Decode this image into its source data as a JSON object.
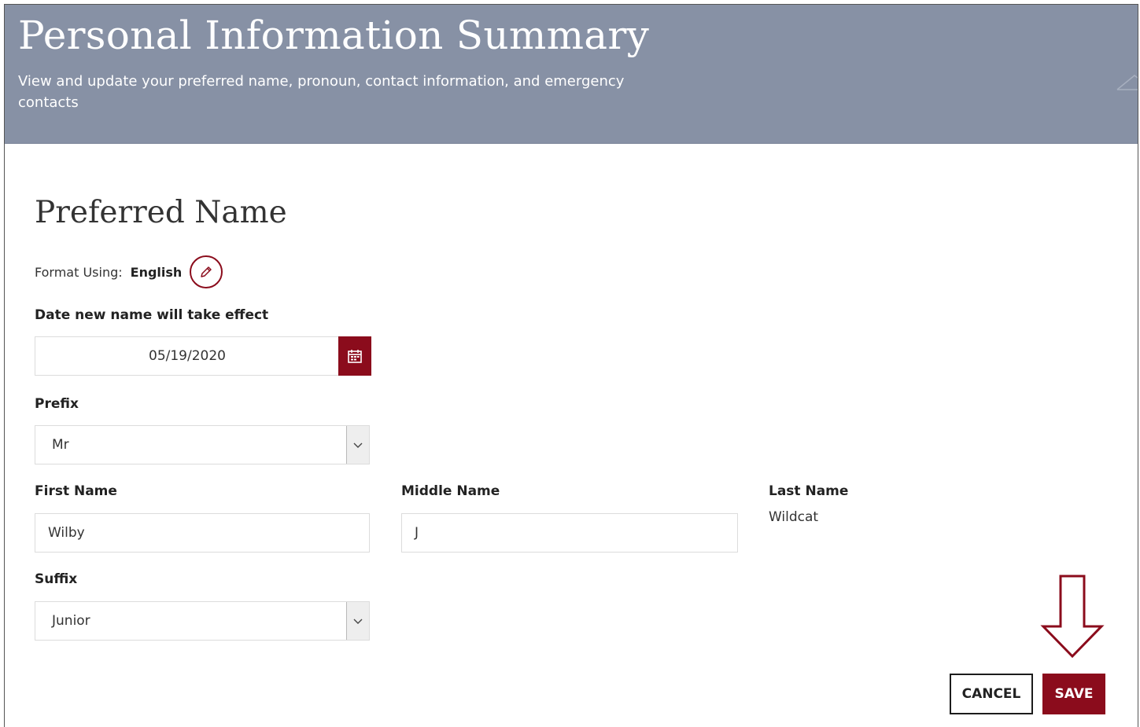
{
  "header": {
    "title": "Personal Information Summary",
    "subtitle": "View and update your preferred name, pronoun, contact information, and emergency contacts"
  },
  "preferred_name": {
    "section_title": "Preferred Name",
    "format_label": "Format Using:",
    "format_value": "English",
    "effective_date": {
      "label": "Date new name will take effect",
      "value": "05/19/2020"
    },
    "prefix": {
      "label": "Prefix",
      "value": "Mr"
    },
    "first_name": {
      "label": "First Name",
      "value": "Wilby"
    },
    "middle_name": {
      "label": "Middle Name",
      "value": "J"
    },
    "last_name": {
      "label": "Last Name",
      "value": "Wildcat"
    },
    "suffix": {
      "label": "Suffix",
      "value": "Junior"
    }
  },
  "actions": {
    "cancel_label": "CANCEL",
    "save_label": "SAVE"
  },
  "icons": {
    "edit": "pencil-icon",
    "calendar": "calendar-icon",
    "dropdown": "chevron-down-icon",
    "collapse": "chevron-up-icon",
    "annotation": "down-arrow-annotation"
  },
  "colors": {
    "banner": "#8791a5",
    "accent": "#8b0c1c",
    "banner_text": "#ffffff"
  }
}
